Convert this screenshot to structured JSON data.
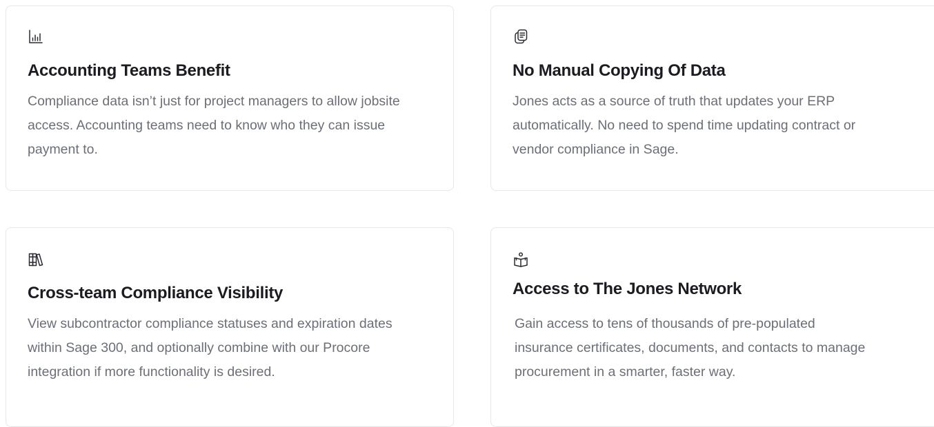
{
  "cards": [
    {
      "icon": "bar-chart-icon",
      "title": "Accounting Teams Benefit",
      "description": "Compliance data isn’t just for project managers to allow jobsite access. Accounting teams need to know who they can issue payment to."
    },
    {
      "icon": "document-stack-icon",
      "title": "No Manual Copying Of Data",
      "description": "Jones acts as a source of truth that updates your ERP automatically. No need to spend time updating contract or vendor compliance in Sage."
    },
    {
      "icon": "books-icon",
      "title": "Cross-team Compliance Visibility",
      "description": "View subcontractor compliance statuses and expiration dates within Sage 300, and optionally combine with our Procore integration if more functionality is desired."
    },
    {
      "icon": "person-reading-icon",
      "title": "Access to The Jones Network",
      "description": "Gain access to tens of thousands of pre-populated insurance certificates, documents, and contacts to manage procurement in a smarter, faster way."
    }
  ]
}
